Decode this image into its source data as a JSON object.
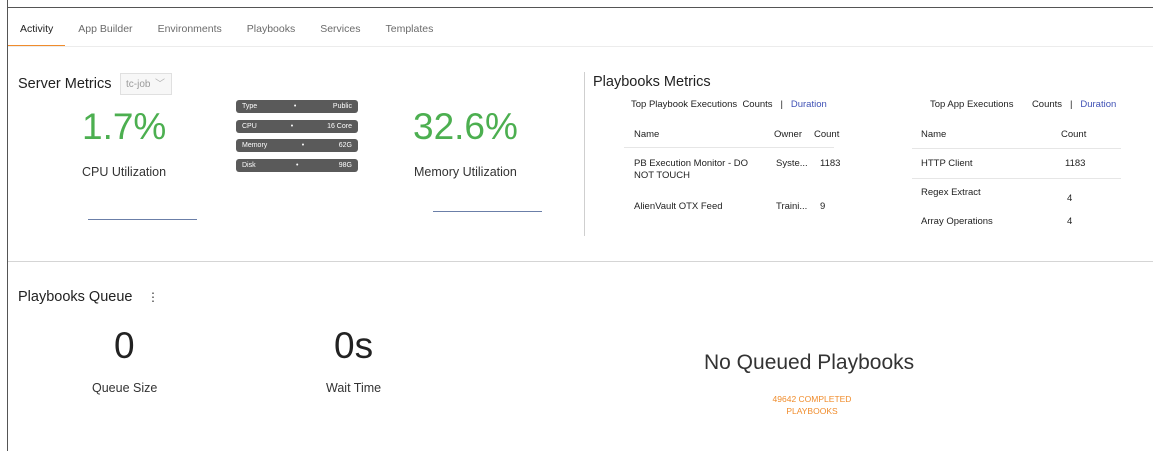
{
  "tabs": [
    "Activity",
    "App Builder",
    "Environments",
    "Playbooks",
    "Services",
    "Templates"
  ],
  "server_metrics": {
    "title": "Server Metrics",
    "selector_value": "tc-job",
    "cpu": {
      "value": "1.7%",
      "label": "CPU Utilization"
    },
    "memory": {
      "value": "32.6%",
      "label": "Memory Utilization"
    },
    "specs": [
      {
        "key": "Type",
        "value": "Public"
      },
      {
        "key": "CPU",
        "value": "16 Core"
      },
      {
        "key": "Memory",
        "value": "62G"
      },
      {
        "key": "Disk",
        "value": "98G"
      }
    ],
    "bullet": "•"
  },
  "playbooks_metrics": {
    "title": "Playbooks Metrics",
    "top_playbooks": {
      "title": "Top Playbook Executions",
      "toggle_counts": "Counts",
      "separator": "|",
      "toggle_duration": "Duration",
      "headers": [
        "Name",
        "Owner",
        "Count"
      ],
      "rows": [
        {
          "name": "PB Execution Monitor - DO NOT TOUCH",
          "owner": "Syste...",
          "count": "1183"
        },
        {
          "name": "AlienVault OTX Feed",
          "owner": "Traini...",
          "count": "9"
        }
      ]
    },
    "top_apps": {
      "title": "Top App Executions",
      "toggle_counts": "Counts",
      "separator": "|",
      "toggle_duration": "Duration",
      "headers": [
        "Name",
        "Count"
      ],
      "rows": [
        {
          "name": "HTTP Client",
          "count": "1183"
        },
        {
          "name": "Regex Extract",
          "count": "4"
        },
        {
          "name": "Array Operations",
          "count": "4"
        }
      ]
    }
  },
  "playbooks_queue": {
    "title": "Playbooks Queue",
    "menu_icon": "⋮",
    "queue_size": {
      "value": "0",
      "label": "Queue Size"
    },
    "wait_time": {
      "value": "0s",
      "label": "Wait Time"
    },
    "empty_message": "No Queued Playbooks",
    "completed_line1": "49642 COMPLETED",
    "completed_line2": "PLAYBOOKS"
  },
  "colors": {
    "accent": "#f08c2c",
    "green": "#4caf50",
    "link": "#3f51b5"
  }
}
